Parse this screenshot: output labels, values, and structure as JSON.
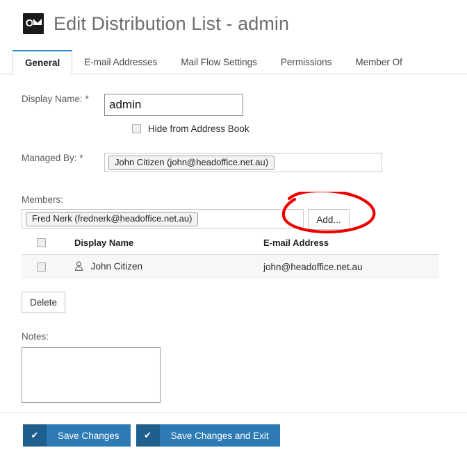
{
  "header": {
    "icon": "outlook-icon",
    "title": "Edit Distribution List - admin"
  },
  "tabs": [
    {
      "label": "General",
      "active": true
    },
    {
      "label": "E-mail Addresses",
      "active": false
    },
    {
      "label": "Mail Flow Settings",
      "active": false
    },
    {
      "label": "Permissions",
      "active": false
    },
    {
      "label": "Member Of",
      "active": false
    }
  ],
  "form": {
    "display_name": {
      "label": "Display Name: *",
      "value": "admin"
    },
    "hide_from_address_book": {
      "label": "Hide from Address Book",
      "checked": false
    },
    "managed_by": {
      "label": "Managed By: *",
      "tokens": [
        "John Citizen (john@headoffice.net.au)"
      ]
    },
    "members": {
      "label": "Members:",
      "tokens": [
        "Fred Nerk (frednerk@headoffice.net.au)"
      ],
      "add_button": "Add...",
      "columns": [
        "Display Name",
        "E-mail Address"
      ],
      "rows": [
        {
          "checked": false,
          "icon": "person-icon",
          "display_name": "John Citizen",
          "email": "john@headoffice.net.au"
        }
      ],
      "delete_button": "Delete"
    },
    "notes": {
      "label": "Notes:",
      "value": ""
    }
  },
  "footer": {
    "save_changes": "Save Changes",
    "save_changes_and_exit": "Save Changes and Exit",
    "check_glyph": "✔"
  },
  "annotation": {
    "type": "hand-drawn-ellipse",
    "color": "#ee0000",
    "targets": "add-button"
  },
  "colors": {
    "accent_tab": "#2e88c7",
    "button_primary": "#2e7ab5",
    "button_primary_dark": "#1e5f8d",
    "title_text": "#6e6e6e",
    "annotation_red": "#ee0000"
  }
}
